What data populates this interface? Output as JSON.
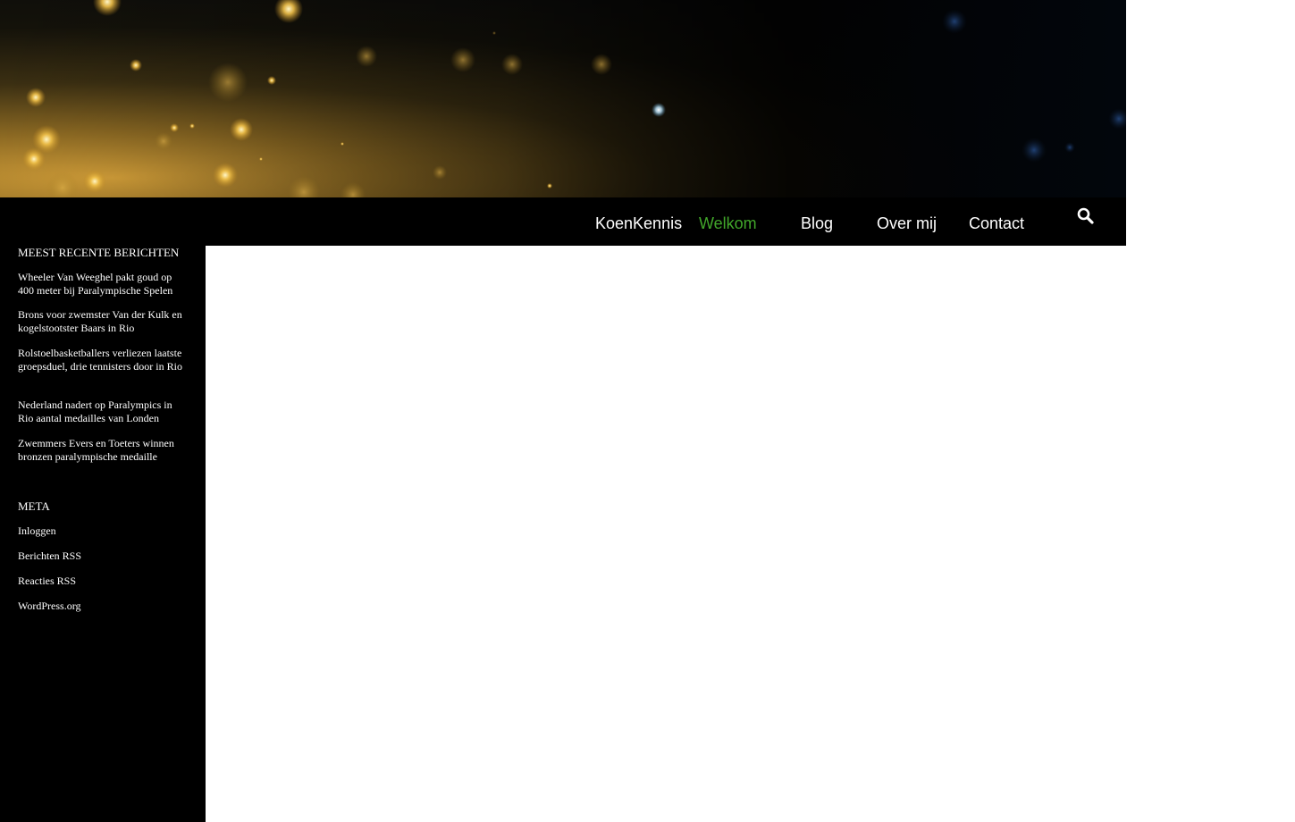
{
  "nav": {
    "items": [
      {
        "label": "KoenKennis",
        "active": false
      },
      {
        "label": "Welkom",
        "active": true
      },
      {
        "label": "Blog",
        "active": false
      },
      {
        "label": "Over mij",
        "active": false
      },
      {
        "label": "Contact",
        "active": false
      }
    ],
    "search_icon": "search-icon",
    "active_color": "#41a62a"
  },
  "sidebar": {
    "recent_title": "MEEST RECENTE BERICHTEN",
    "recent_posts": [
      "Wheeler Van Weeghel pakt goud op 400 meter bij Paralympische Spelen",
      "Brons voor zwemster Van der Kulk en kogelstootster Baars in Rio",
      "Rolstoelbasketballers verliezen laatste groepsduel, drie tennisters door in Rio",
      "Nederland nadert op Paralympics in Rio aantal medailles van Londen",
      "Zwemmers Evers en Toeters winnen bronzen paralympische medaille"
    ],
    "meta_title": "META",
    "meta_links": [
      "Inloggen",
      "Berichten RSS",
      "Reacties RSS",
      "WordPress.org"
    ]
  }
}
